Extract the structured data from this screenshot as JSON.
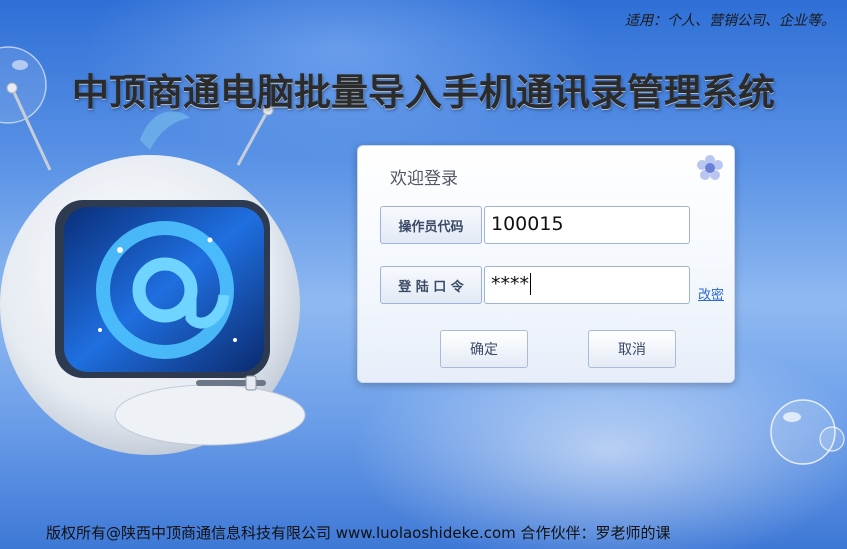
{
  "header": {
    "applicable_note": "适用：个人、营销公司、企业等。",
    "title": "中顶商通电脑批量导入手机通讯录管理系统"
  },
  "login": {
    "heading": "欢迎登录",
    "operator_label": "操作员代码",
    "operator_value": "100015",
    "password_label": "登 陆 口 令",
    "password_value": "****",
    "change_password_link": "改密",
    "confirm_button": "确定",
    "cancel_button": "取消"
  },
  "footer": {
    "copyright": "版权所有@陕西中顶商通信息科技有限公司  www.luolaoshideke.com  合作伙伴：罗老师的课"
  },
  "colors": {
    "background_top": "#2f6fd6",
    "background_mid": "#8fb9f1",
    "screen_blue": "#1f6fe0",
    "link": "#2a6bd6"
  },
  "icons": [
    "tv-at-icon",
    "flower-icon",
    "bubble-icon"
  ]
}
